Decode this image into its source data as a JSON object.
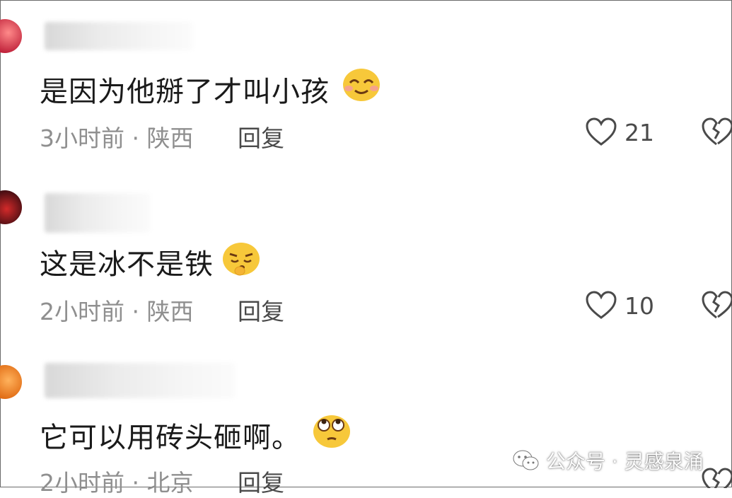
{
  "comments": [
    {
      "text": "是因为他掰了才叫小孩",
      "time": "3小时前",
      "location": "陕西",
      "reply_label": "回复",
      "likes": "21"
    },
    {
      "text": "这是冰不是铁",
      "time": "2小时前",
      "location": "陕西",
      "reply_label": "回复",
      "likes": "10"
    },
    {
      "text": "它可以用砖头砸啊。",
      "time": "2小时前",
      "location": "北京",
      "reply_label": "回复"
    }
  ],
  "meta_separator": "·",
  "watermark": {
    "text": "公众号 · 灵感泉涌"
  },
  "colors": {
    "text": "#1a1a1a",
    "meta": "#8f8f8f",
    "icon": "#4a4a4a",
    "emoji": "#f7c83a"
  }
}
